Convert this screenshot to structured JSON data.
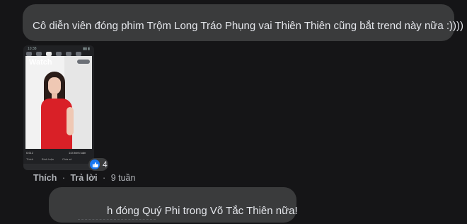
{
  "comments": [
    {
      "text": "Cô diễn viên đóng phim Trộm Long Tráo Phụng vai Thiên Thiên cũng bắt trend này nữa :))))"
    },
    {
      "text": "h đóng Quý Phi trong Võ Tắc Thiên nữa!"
    }
  ],
  "attachment": {
    "status_time": "10:38",
    "tab_title": "Watch",
    "reactions_count": "6.612",
    "comments_count": "144 bình luận",
    "actions": [
      "Thích",
      "Bình luận",
      "Chia sẻ"
    ]
  },
  "reaction": {
    "icon": "like-icon",
    "count": "4",
    "color": "#1877f2"
  },
  "comment_actions": {
    "like": "Thích",
    "reply": "Trả lời",
    "time": "9 tuần"
  },
  "colors": {
    "background": "#151517",
    "bubble": "#3a3b3c",
    "text": "#e4e6eb",
    "muted": "#b0b3b8"
  }
}
